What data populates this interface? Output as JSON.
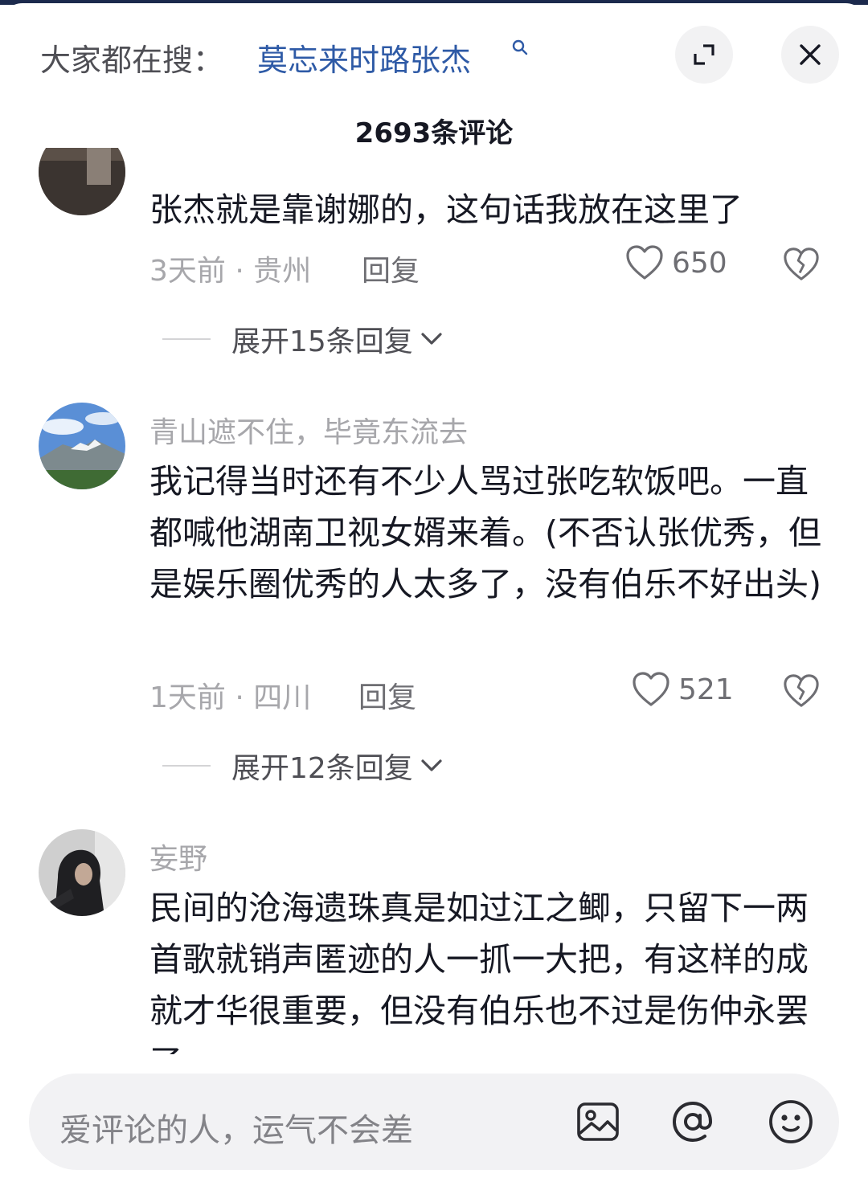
{
  "header": {
    "hint_label": "大家都在搜：",
    "search_term": "莫忘来时路张杰",
    "comment_count": "2693条评论"
  },
  "comments": [
    {
      "username": "",
      "text": "张杰就是靠谢娜的，这句话我放在这里了",
      "meta": "3天前 · 贵州",
      "reply_label": "回复",
      "likes": "650",
      "expand_label": "展开15条回复"
    },
    {
      "username": "青山遮不住，毕竟东流去",
      "text": "我记得当时还有不少人骂过张吃软饭吧。一直都喊他湖南卫视女婿来着。(不否认张优秀，但是娱乐圈优秀的人太多了，没有伯乐不好出头)",
      "meta": "1天前 · 四川",
      "reply_label": "回复",
      "likes": "521",
      "expand_label": "展开12条回复"
    },
    {
      "username": "妄野",
      "text": "民间的沧海遗珠真是如过江之鲫，只留下一两首歌就销声匿迹的人一抓一大把，有这样的成就才华很重要，但没有伯乐也不过是伤仲永罢了"
    }
  ],
  "input": {
    "placeholder": "爱评论的人，运气不会差"
  },
  "icons": {
    "search": "search-icon",
    "expand": "expand-icon",
    "close": "close-icon",
    "like": "heart-icon",
    "dislike": "broken-heart-icon",
    "image": "image-icon",
    "at": "at-icon",
    "emoji": "emoji-icon"
  }
}
